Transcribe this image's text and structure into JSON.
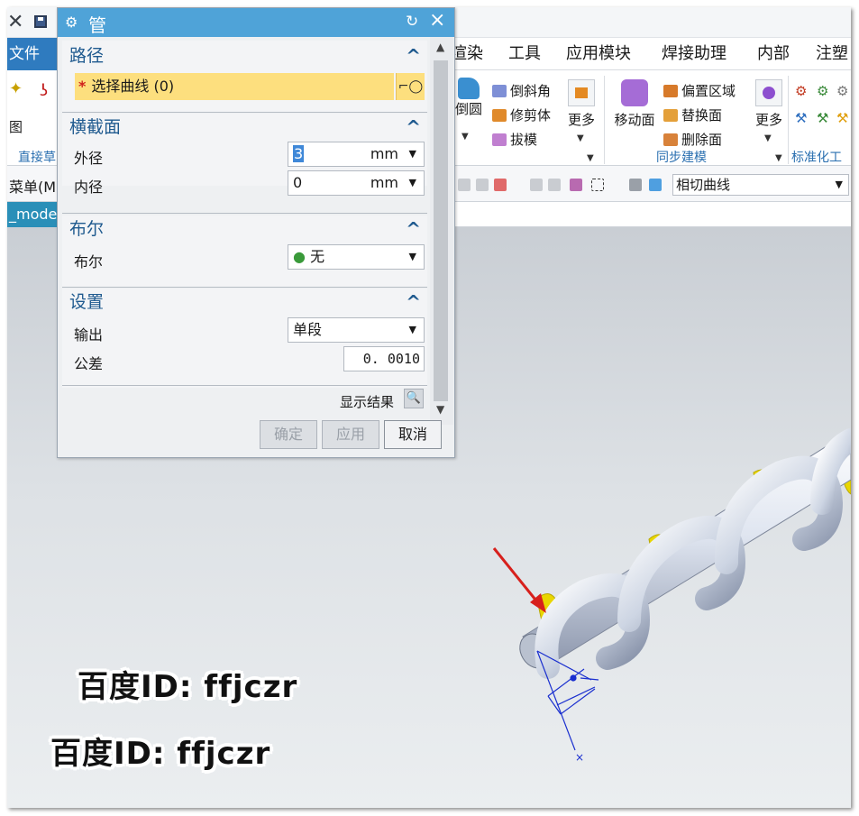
{
  "app": {
    "file_menu": "文件(F)",
    "menus": [
      "渲染",
      "工具",
      "应用模块",
      "焊接助理",
      "内部",
      "注塑"
    ],
    "ribbon": {
      "left_label_top": "图",
      "left_group_label": "直接草",
      "chamfer_col": {
        "round": "倒圆",
        "chamfer": "倒斜角",
        "trim_body": "修剪体",
        "draft": "拔模",
        "more": "更多"
      },
      "sync_col": {
        "move_face": "移动面",
        "offset_region": "偏置区域",
        "replace_face": "替换面",
        "delete_face": "删除面",
        "more": "更多"
      },
      "sync_group_label": "同步建模",
      "std_group_label": "标准化工"
    },
    "command_bar": {
      "menu_label": "菜单(M",
      "curve_rule": "相切曲线"
    },
    "model_tab": "_mode"
  },
  "dialog": {
    "title": "管",
    "sections": {
      "path": {
        "title": "路径",
        "select_curve": "选择曲线 (0)"
      },
      "cross_section": {
        "title": "横截面",
        "outer_label": "外径",
        "outer_value": "3",
        "outer_unit": "mm",
        "inner_label": "内径",
        "inner_value": "0",
        "inner_unit": "mm"
      },
      "boolean": {
        "title": "布尔",
        "label": "布尔",
        "value": "无"
      },
      "settings": {
        "title": "设置",
        "output_label": "输出",
        "output_value": "单段",
        "tolerance_label": "公差",
        "tolerance_value": "0. 0010"
      }
    },
    "show_result": "显示结果",
    "buttons": {
      "ok": "确定",
      "apply": "应用",
      "cancel": "取消"
    }
  },
  "watermarks": [
    "百度ID: ffjczr",
    "百度ID: ffjczr"
  ],
  "colors": {
    "dialog_title": "#4fa3d8",
    "section_title": "#1f5a8f",
    "selection_highlight": "#fddf7e",
    "required_star": "#d0201c",
    "helix_surface": "#e9d600",
    "arrow": "#d7201c",
    "csys": "#1a2fcf"
  }
}
